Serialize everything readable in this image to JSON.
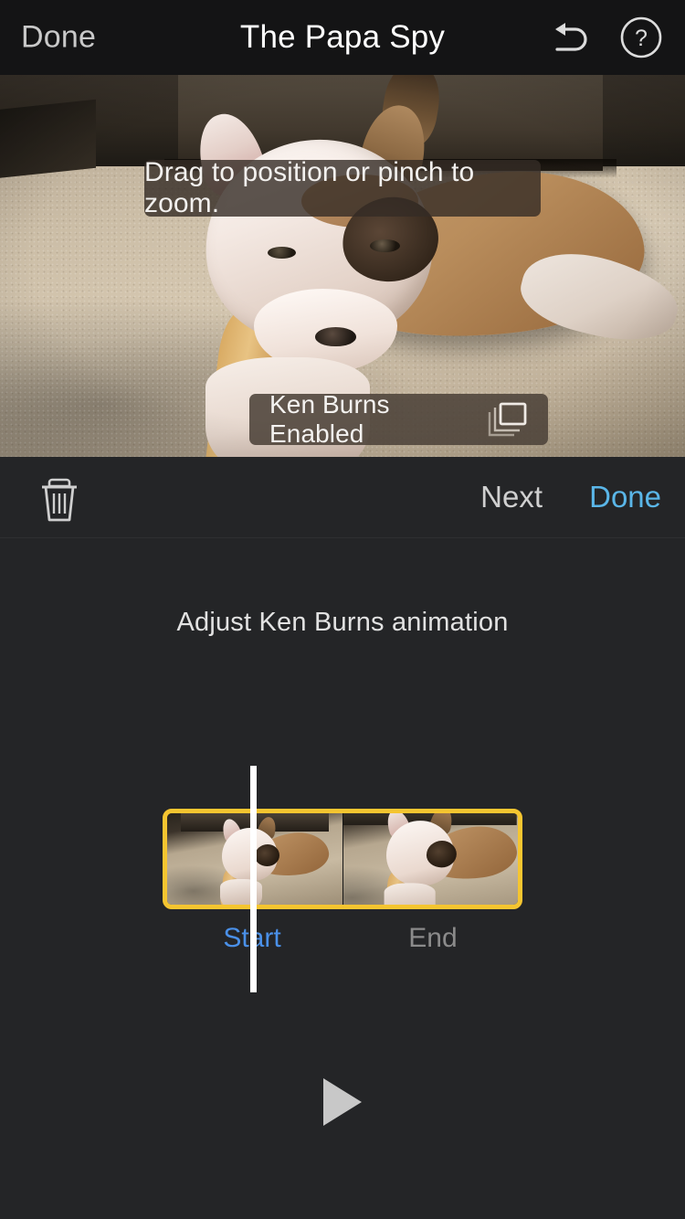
{
  "app": {
    "accent_blue": "#5ab6e8",
    "label_blue": "#4a90e8",
    "selection_yellow": "#f5c530",
    "background": "#242527",
    "topbar_background": "#141415"
  },
  "topbar": {
    "done_label": "Done",
    "title": "The Papa Spy",
    "undo_icon": "undo-arrow-icon",
    "help_icon": "question-mark-circle-icon"
  },
  "preview": {
    "hint_text": "Drag to position or pinch to zoom.",
    "kenburns_badge": {
      "label": "Ken Burns Enabled",
      "icon": "stacked-frames-icon"
    }
  },
  "edit_toolbar": {
    "delete_icon": "trash-icon",
    "next_label": "Next",
    "done_label": "Done"
  },
  "panel": {
    "caption": "Adjust Ken Burns animation",
    "filmstrip": {
      "selected": true,
      "frames": [
        {
          "name": "start-frame"
        },
        {
          "name": "end-frame"
        }
      ]
    },
    "labels": {
      "start": "Start",
      "end": "End"
    },
    "play_icon": "play-triangle-icon"
  }
}
